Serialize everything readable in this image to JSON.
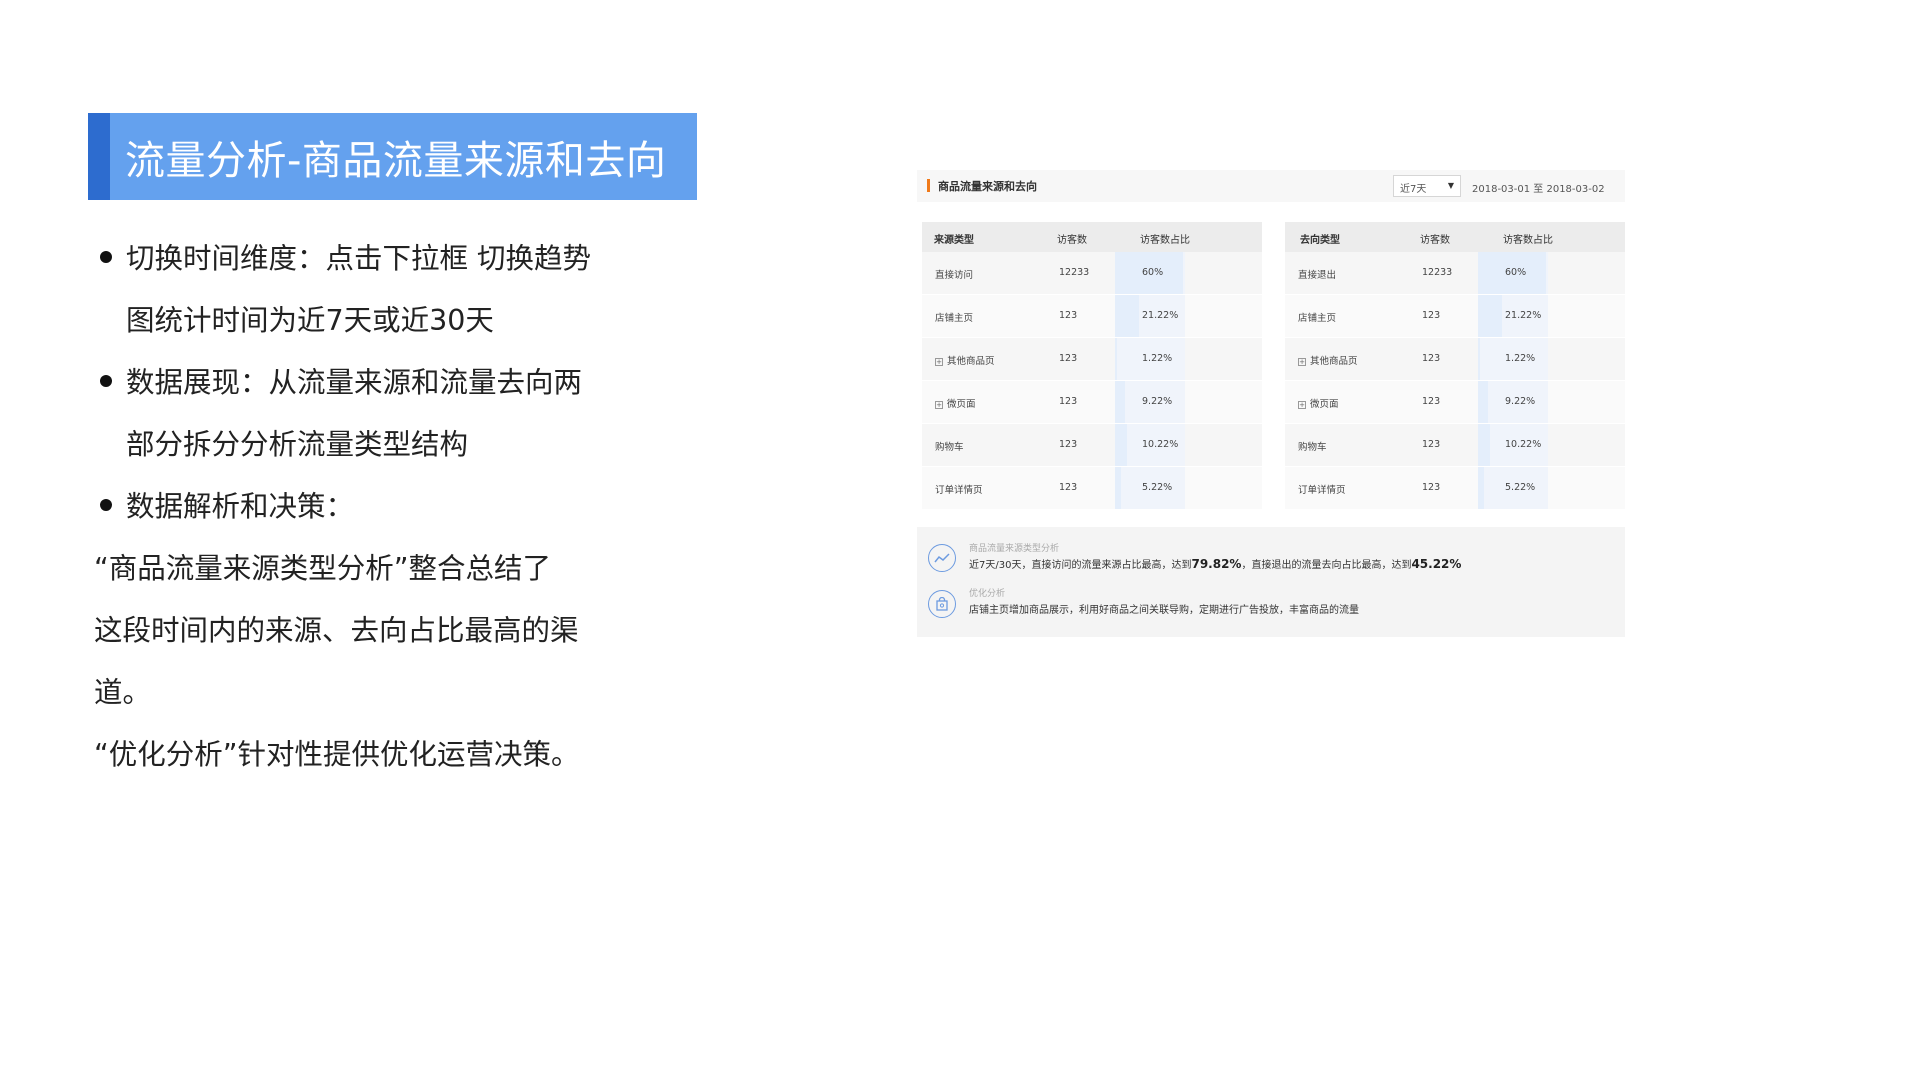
{
  "slide": {
    "title": "流量分析-商品流量来源和去向",
    "body_lines": [
      {
        "text": "切换时间维度：点击下拉框 切换趋势",
        "bullet": true
      },
      {
        "text": "图统计时间为近7天或近30天",
        "bullet": false
      },
      {
        "text": "数据展现：从流量来源和流量去向两",
        "bullet": true
      },
      {
        "text": "部分拆分分析流量类型结构",
        "bullet": false
      },
      {
        "text": "数据解析和决策：",
        "bullet": true
      },
      {
        "text": "“商品流量来源类型分析”整合总结了",
        "bullet": false
      },
      {
        "text": "这段时间内的来源、去向占比最高的渠",
        "bullet": false
      },
      {
        "text": "道。",
        "bullet": false
      },
      {
        "text": "“优化分析”针对性提供优化运营决策。",
        "bullet": false
      }
    ]
  },
  "panel": {
    "title": "商品流量来源和去向",
    "accent_color": "#f07a1a",
    "period_select": "近7天",
    "date_range": "2018-03-01 至 2018-03-02",
    "source_table": {
      "headers": [
        "来源类型",
        "访客数",
        "访客数占比"
      ],
      "rows": [
        {
          "name": "直接访问",
          "visitors": "12233",
          "ratio": "60%",
          "ratio_value": 60,
          "expandable": false
        },
        {
          "name": "店铺主页",
          "visitors": "123",
          "ratio": "21.22%",
          "ratio_value": 21.22,
          "expandable": false
        },
        {
          "name": "其他商品页",
          "visitors": "123",
          "ratio": "1.22%",
          "ratio_value": 1.22,
          "expandable": true
        },
        {
          "name": "微页面",
          "visitors": "123",
          "ratio": "9.22%",
          "ratio_value": 9.22,
          "expandable": true
        },
        {
          "name": "购物车",
          "visitors": "123",
          "ratio": "10.22%",
          "ratio_value": 10.22,
          "expandable": false
        },
        {
          "name": "订单详情页",
          "visitors": "123",
          "ratio": "5.22%",
          "ratio_value": 5.22,
          "expandable": false
        }
      ]
    },
    "dest_table": {
      "headers": [
        "去向类型",
        "访客数",
        "访客数占比"
      ],
      "rows": [
        {
          "name": "直接退出",
          "visitors": "12233",
          "ratio": "60%",
          "ratio_value": 60,
          "expandable": false
        },
        {
          "name": "店铺主页",
          "visitors": "123",
          "ratio": "21.22%",
          "ratio_value": 21.22,
          "expandable": false
        },
        {
          "name": "其他商品页",
          "visitors": "123",
          "ratio": "1.22%",
          "ratio_value": 1.22,
          "expandable": true
        },
        {
          "name": "微页面",
          "visitors": "123",
          "ratio": "9.22%",
          "ratio_value": 9.22,
          "expandable": true
        },
        {
          "name": "购物车",
          "visitors": "123",
          "ratio": "10.22%",
          "ratio_value": 10.22,
          "expandable": false
        },
        {
          "name": "订单详情页",
          "visitors": "123",
          "ratio": "5.22%",
          "ratio_value": 5.22,
          "expandable": false
        }
      ]
    },
    "insights": {
      "analysis_label": "商品流量来源类型分析",
      "analysis_text_1": "近7天/30天，直接访问的流量来源占比最高，达到",
      "analysis_value_1": "79.82%",
      "analysis_text_2": "，直接退出的流量去向占比最高，达到",
      "analysis_value_2": "45.22%",
      "optimize_label": "优化分析",
      "optimize_text": "店铺主页增加商品展示，利用好商品之间关联导购，定期进行广告投放，丰富商品的流量"
    }
  }
}
